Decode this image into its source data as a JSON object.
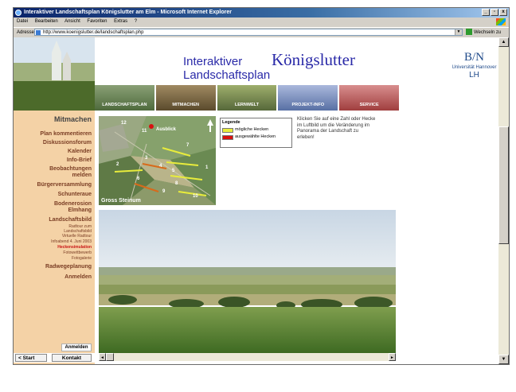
{
  "window": {
    "title": "Interaktiver Landschaftsplan Königslutter am Elm - Microsoft Internet Explorer",
    "minimize": "_",
    "maximize": "▫",
    "close": "x"
  },
  "menu": [
    "Datei",
    "Bearbeiten",
    "Ansicht",
    "Favoriten",
    "Extras",
    "?"
  ],
  "address": {
    "label": "Adresse",
    "url": "http://www.koenigslutter.de/landschaftsplan.php",
    "go_label": "Wechseln zu"
  },
  "header": {
    "title_line1": "Interaktiver",
    "title_line2": "Landschaftsplan",
    "brand": "Königslutter",
    "uni_logo": "B/N",
    "uni_name": "Universität Hannover",
    "uni_abbr": "LH"
  },
  "nav_tabs": [
    {
      "label": "LANDSCHAFTSPLAN",
      "color": "#5d7a4a"
    },
    {
      "label": "MITMACHEN",
      "color": "#6b5a3a"
    },
    {
      "label": "LERNWELT",
      "color": "#6d7e48"
    },
    {
      "label": "PROJEKT-INFO",
      "color": "#6e88b8"
    },
    {
      "label": "SERVICE",
      "color": "#b45252"
    }
  ],
  "sidebar": {
    "heading": "Mitmachen",
    "items": [
      "Plan kommentieren",
      "Diskussionsforum",
      "Kalender",
      "Info-Brief",
      "Beobachtungen",
      "melden",
      "Bürgerversammlung",
      "Schunteraue",
      "Bodenerosion",
      "Elmhang",
      "Landschaftsbild"
    ],
    "subitems": [
      "Radtour zum",
      "Landschaftsbild",
      "Virtuelle Radtour",
      "Infoabend 4. Juni 2003",
      "Heckensimulation",
      "Fotowettbewerb",
      "Fotogalerie"
    ],
    "items_after": [
      "Radwegeplanung",
      "Anmelden"
    ],
    "anmelden_button": "Anmelden",
    "start_button": "< Start",
    "kontakt_button": "Kontakt",
    "bg_color": "#f4d2a6",
    "text_color": "#7a3d24",
    "active_color": "#c81414"
  },
  "aerial": {
    "marker_label": "Ausblick",
    "caption": "Gross Steinum",
    "numbers": [
      "12",
      "11",
      "7",
      "2",
      "3",
      "4",
      "5",
      "6",
      "8",
      "9",
      "10",
      "1"
    ]
  },
  "legend": {
    "heading": "Legende",
    "items": [
      {
        "label": "mögliche Hecken",
        "color": "#e8ec3c"
      },
      {
        "label": "ausgewählte Hecken",
        "color": "#d81010"
      }
    ]
  },
  "instructions": "Klicken Sie auf eine Zahl oder Hecke im Luftbild um die Veränderung im Panorama der Landschaft zu erleben!"
}
